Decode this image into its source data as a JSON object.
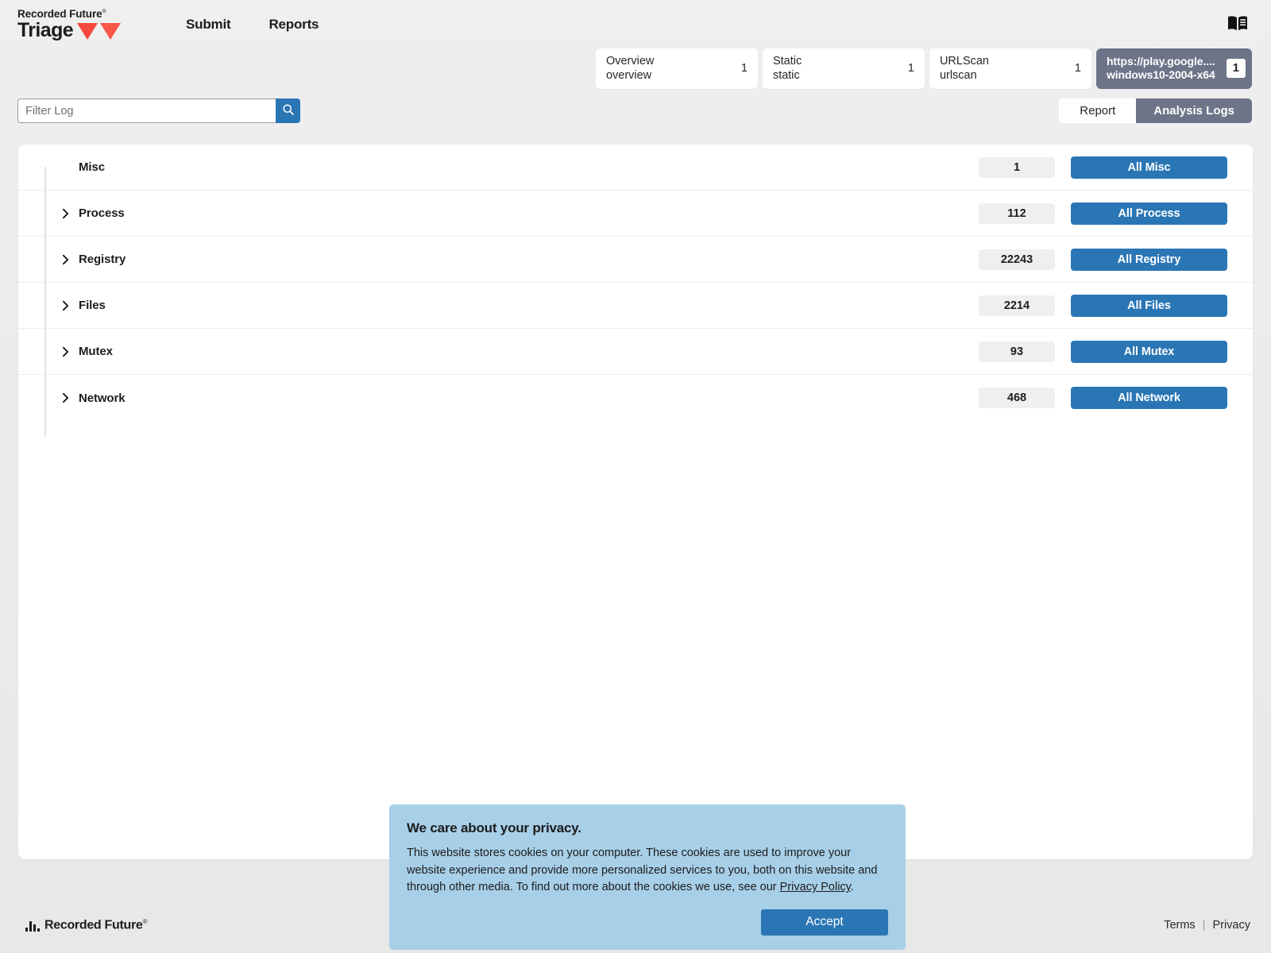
{
  "header": {
    "brand_top": "Recorded Future",
    "brand_bottom": "Triage",
    "nav": [
      {
        "label": "Submit"
      },
      {
        "label": "Reports"
      }
    ],
    "doc_icon": "book-icon"
  },
  "tabs": [
    {
      "title": "Overview",
      "sub": "overview",
      "count": "1",
      "active": false
    },
    {
      "title": "Static",
      "sub": "static",
      "count": "1",
      "active": false
    },
    {
      "title": "URLScan",
      "sub": "urlscan",
      "count": "1",
      "active": false
    },
    {
      "title": "https://play.google....",
      "sub": "windows10-2004-x64",
      "count": "1",
      "active": true
    }
  ],
  "toolbar": {
    "filter_placeholder": "Filter Log",
    "filter_value": "",
    "search_icon": "search-icon",
    "report_label": "Report",
    "analysis_logs_label": "Analysis Logs"
  },
  "log_sections": [
    {
      "label": "Misc",
      "count": "1",
      "button": "All Misc",
      "expandable": false
    },
    {
      "label": "Process",
      "count": "112",
      "button": "All Process",
      "expandable": true
    },
    {
      "label": "Registry",
      "count": "22243",
      "button": "All Registry",
      "expandable": true
    },
    {
      "label": "Files",
      "count": "2214",
      "button": "All Files",
      "expandable": true
    },
    {
      "label": "Mutex",
      "count": "93",
      "button": "All Mutex",
      "expandable": true
    },
    {
      "label": "Network",
      "count": "468",
      "button": "All Network",
      "expandable": true
    }
  ],
  "cookie_banner": {
    "title": "We care about your privacy.",
    "body_before": "This website stores cookies on your computer. These cookies are used to improve your website experience and provide more personalized services to you, both on this website and through other media. To find out more about the cookies we use, see our ",
    "link": "Privacy Policy",
    "body_after": ".",
    "accept_label": "Accept"
  },
  "footer": {
    "logo_text": "Recorded Future",
    "terms": "Terms",
    "separator": "|",
    "privacy": "Privacy"
  },
  "colors": {
    "accent_blue": "#2a76b5",
    "slate": "#6d7488",
    "brand_red": "#f4483c",
    "banner_blue": "#a8cfe8"
  }
}
